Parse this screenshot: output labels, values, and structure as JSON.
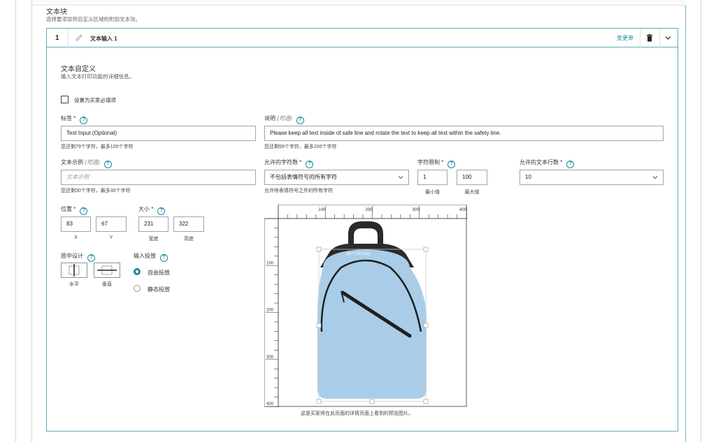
{
  "section": {
    "title": "文本块",
    "subtitle": "选择要添加到自定义区域的附加文本块。"
  },
  "card": {
    "number": "1",
    "title": "文本输入 1",
    "change_link": "变更单",
    "icons": {
      "edit": "pencil-icon",
      "delete": "trash-icon",
      "collapse": "chevron-down-icon"
    }
  },
  "customize": {
    "title": "文本自定义",
    "subtitle": "输入文本打印功能的详细信息。",
    "required_checkbox": {
      "label": "设置为买家必填项",
      "checked": false
    }
  },
  "fields": {
    "label": {
      "label": "标签 *",
      "value": "Text Input (Optional)",
      "helper": "您还剩79个字符，最多100个字符"
    },
    "description": {
      "label": "说明",
      "optional": "(可选)",
      "value": "Please keep all text inside of safe line and rotate the text to keep all text within the safety line.",
      "helper": "您还剩99个字符，最多200个字符"
    },
    "text_example": {
      "label": "文本示例",
      "optional": "(可选)",
      "placeholder": "文本示例",
      "helper": "您还剩30个字符，最多30个字符"
    },
    "allowed_chars": {
      "label": "允许的字符数 *",
      "value": "不包括表情符号的所有字符",
      "helper": "允许除表情符号之外的所有字符"
    },
    "char_limit": {
      "label": "字符限制 *",
      "min": "1",
      "max": "100",
      "min_label": "最小值",
      "max_label": "最大值"
    },
    "allowed_lines": {
      "label": "允许的文本行数 *",
      "value": "10"
    },
    "position": {
      "label": "位置 *",
      "x": "83",
      "y": "67",
      "x_label": "X",
      "y_label": "Y"
    },
    "size": {
      "label": "大小 *",
      "width": "231",
      "height": "322",
      "width_label": "宽度",
      "height_label": "高度"
    },
    "centering": {
      "label": "居中设计",
      "horizontal": "水平",
      "vertical": "垂直"
    },
    "input_placement": {
      "label": "输入投放",
      "options": [
        "自由投放",
        "静态投放"
      ],
      "selected": "自由投放"
    }
  },
  "preview": {
    "ruler_top": [
      "100",
      "200",
      "300",
      "400"
    ],
    "ruler_left": [
      "100",
      "200",
      "300",
      "400"
    ],
    "size_tag": "px × 322 px)",
    "caption": "这是买家将在此页面的详情页面上看到的预览图片。",
    "bag_color": "#a9cde8"
  },
  "colors": {
    "accent": "#1a8a97",
    "border": "#5bb0b8"
  }
}
